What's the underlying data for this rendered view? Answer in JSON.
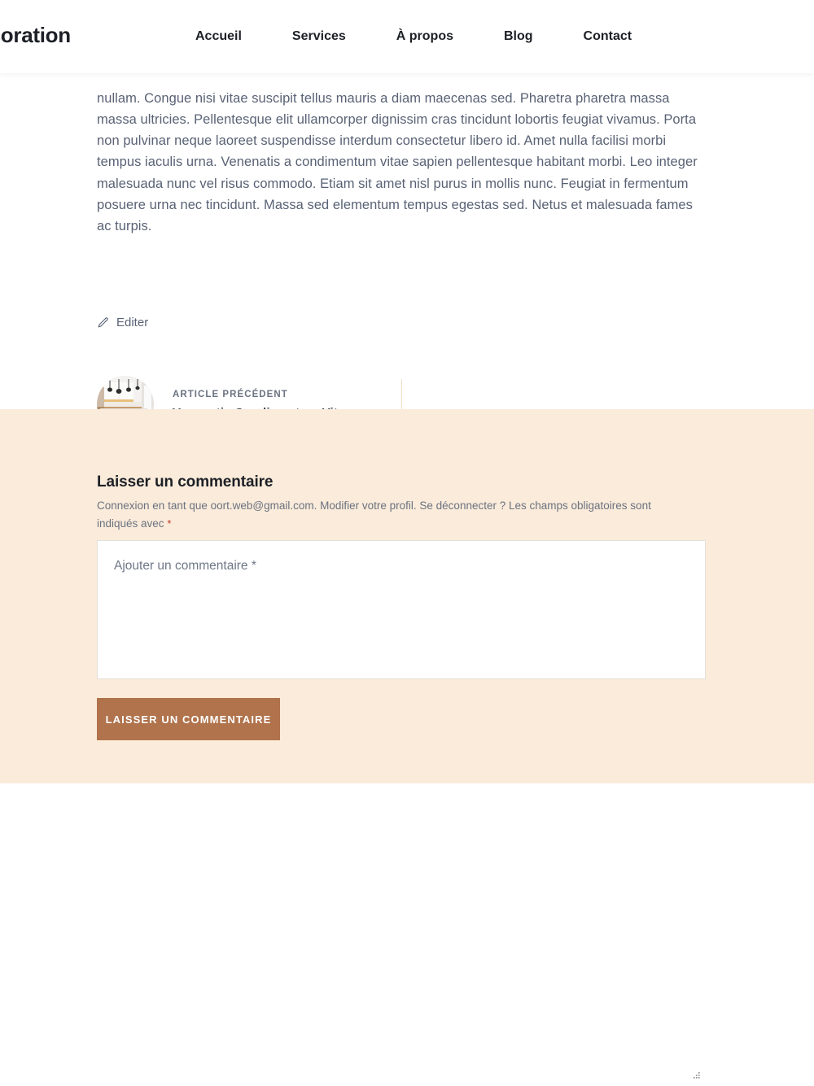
{
  "header": {
    "brand": "Décoration",
    "nav": [
      {
        "label": "Accueil",
        "name": "nav-accueil"
      },
      {
        "label": "Services",
        "name": "nav-services"
      },
      {
        "label": "À propos",
        "name": "nav-a-propos"
      },
      {
        "label": "Blog",
        "name": "nav-blog"
      },
      {
        "label": "Contact",
        "name": "nav-contact"
      }
    ]
  },
  "article": {
    "body": "nullam. Congue nisi vitae suscipit tellus mauris a diam maecenas sed. Pharetra pharetra massa massa ultricies. Pellentesque elit ullamcorper dignissim cras tincidunt lobortis feugiat vivamus. Porta non pulvinar neque laoreet suspendisse interdum consectetur libero id. Amet nulla facilisi morbi tempus iaculis urna. Venenatis a condimentum vitae sapien pellentesque habitant morbi. Leo integer malesuada nunc vel risus commodo. Etiam sit amet nisl purus in mollis nunc. Feugiat in fermentum posuere urna nec tincidunt. Massa sed elementum tempus egestas sed. Netus et malesuada fames ac turpis.",
    "edit_label": "Editer",
    "edit_icon": "pencil-icon"
  },
  "post_nav": {
    "previous": {
      "label": "ARTICLE PRÉCÉDENT",
      "title": "Venenatis Condimentum Vitae",
      "thumbnail_alt": "kitchen-interior-thumbnail"
    }
  },
  "comments": {
    "title": "Laisser un commentaire",
    "login_note_before_email": "Connexion en tant que ",
    "login_email": "oort.web@gmail.com",
    "login_note_after_email": ". Modifier votre profil. Se déconnecter ? Les champs obligatoires sont indiqués avec ",
    "required_mark": "*",
    "textarea_placeholder": "Ajouter un commentaire *",
    "textarea_value": "",
    "submit_label": "Laisser un commentaire"
  },
  "colors": {
    "accent_button": "#b0734c",
    "section_background": "#faebda",
    "text_body": "#596275",
    "heading": "#1d2026",
    "required_red": "#c0392b",
    "divider": "#f3dfc6"
  }
}
